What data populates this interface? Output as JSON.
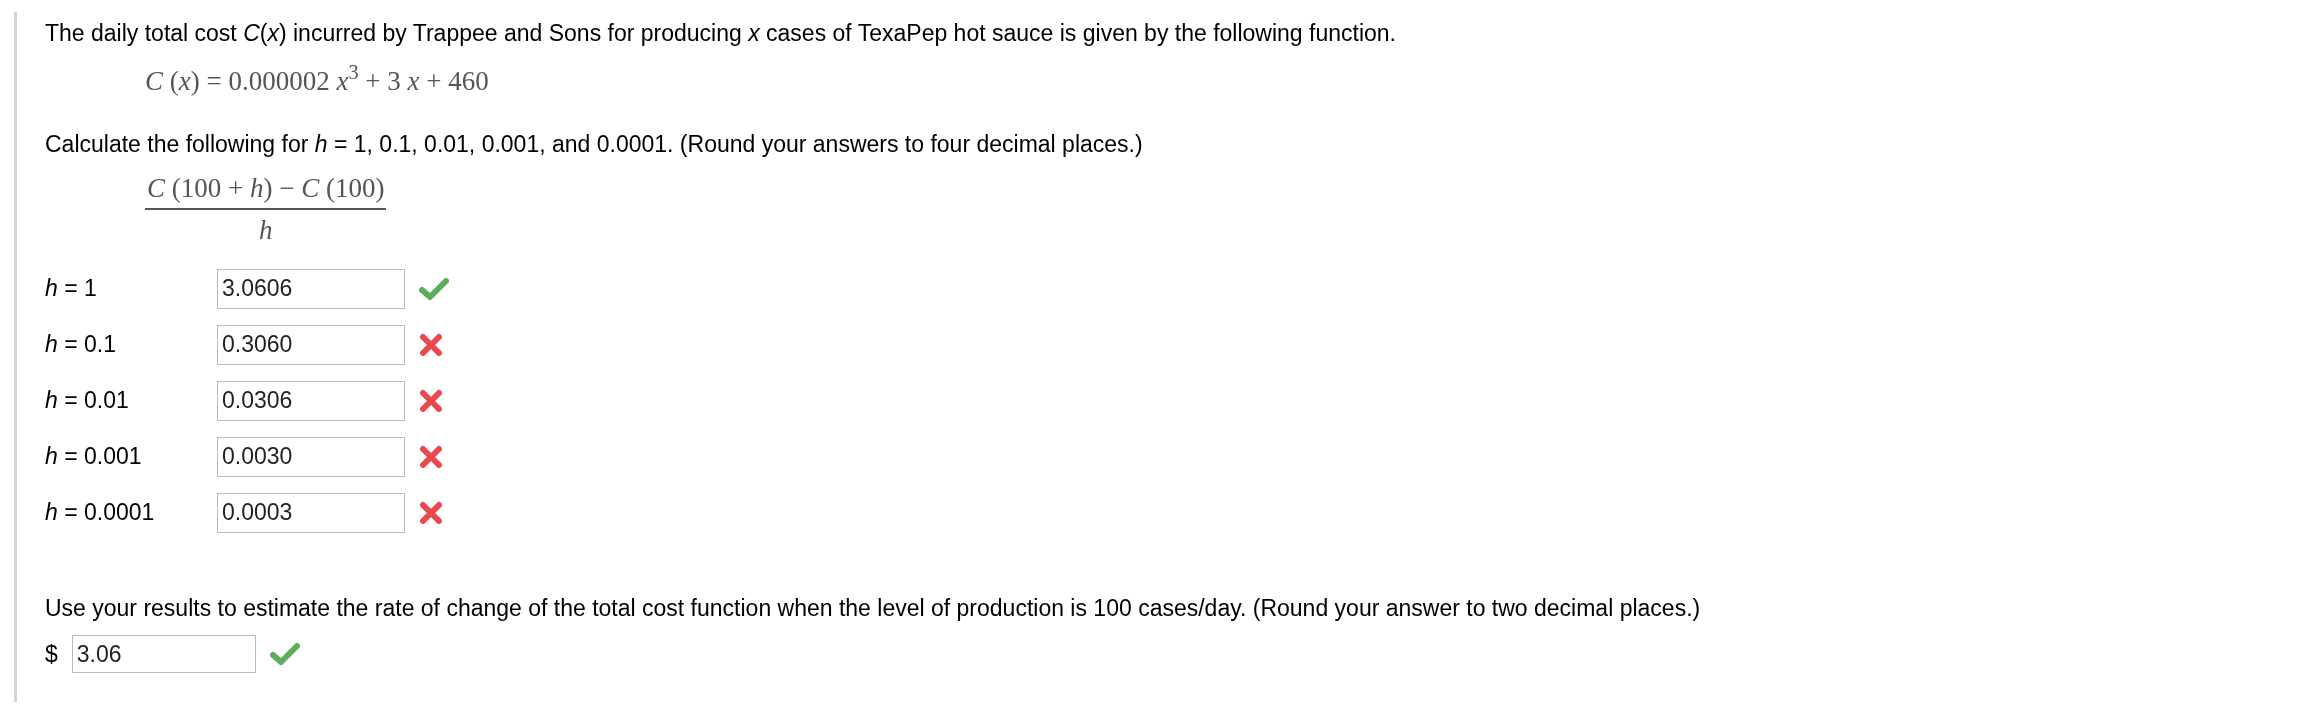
{
  "intro": "The daily total cost *C*(*x*) incurred by Trappee and Sons for producing *x* cases of TexaPep hot sauce is given by the following function.",
  "function_formula": "*C* (*x*) = 0.000002 *x*$^{3}$ + 3 *x* + 460",
  "instruction": "Calculate the following for *h* = 1, 0.1, 0.01, 0.001, and 0.0001. (Round your answers to four decimal places.)",
  "fraction": {
    "numerator": "*C* (100 + *h*) − *C* (100)",
    "denominator": "*h*"
  },
  "answers": [
    {
      "label": "*h* = 1",
      "value": "3.0606",
      "correct": true
    },
    {
      "label": "*h* = 0.1",
      "value": "0.3060",
      "correct": false
    },
    {
      "label": "*h* = 0.01",
      "value": "0.0306",
      "correct": false
    },
    {
      "label": "*h* = 0.001",
      "value": "0.0030",
      "correct": false
    },
    {
      "label": "*h* = 0.0001",
      "value": "0.0003",
      "correct": false
    }
  ],
  "question": "Use your results to estimate the rate of change of the total cost function when the level of production is 100 cases/day. (Round your answer to two decimal places.)",
  "final_answer": {
    "prefix": "$",
    "value": "3.06",
    "correct": true
  }
}
